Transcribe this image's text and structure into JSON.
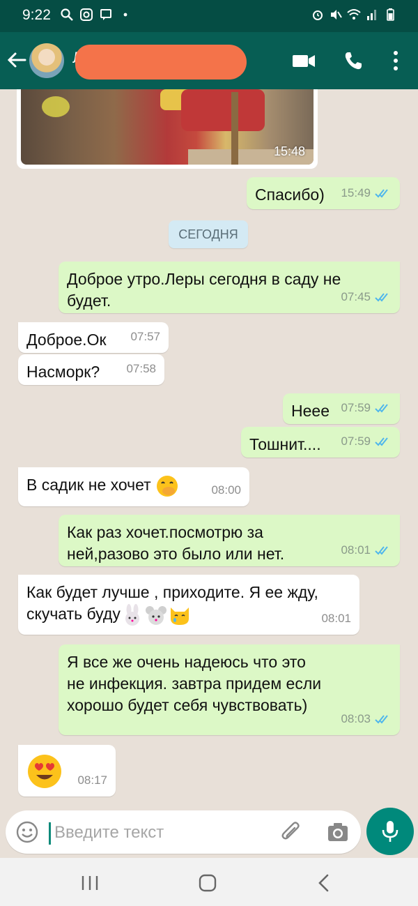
{
  "status_bar": {
    "time": "9:22"
  },
  "header": {
    "contact_name": "Л"
  },
  "media_message": {
    "time": "15:48"
  },
  "messages": [
    {
      "dir": "out",
      "text": "Спасибо)",
      "time": "15:49"
    },
    {
      "dir": "out",
      "text": "Доброе утро.Леры сегодня в саду не будет.",
      "time": "07:45"
    },
    {
      "dir": "in",
      "text": "Доброе.Ок",
      "time": "07:57"
    },
    {
      "dir": "in",
      "text": "Насморк?",
      "time": "07:58"
    },
    {
      "dir": "out",
      "text": "Нееe",
      "time": "07:59"
    },
    {
      "dir": "out",
      "text": "Тошнит....",
      "time": "07:59"
    },
    {
      "dir": "in",
      "text": "В садик не хочет",
      "time": "08:00"
    },
    {
      "dir": "out",
      "text": "Как раз хочет.посмотрю за ней,разово это было или нет.",
      "time": "08:01"
    },
    {
      "dir": "in",
      "text": "Как будет лучше , приходите. Я ее жду, скучать буду",
      "time": "08:01"
    },
    {
      "dir": "out",
      "text": "Я все же очень надеюсь что это не инфекция. завтра придем если хорошо будет себя чувствовать)",
      "time": "08:03"
    },
    {
      "dir": "in",
      "text": "",
      "time": "08:17"
    }
  ],
  "day_separator": "СЕГОДНЯ",
  "input": {
    "placeholder": "Введите текст"
  },
  "colors": {
    "header": "#075e54",
    "status_bar": "#054d44",
    "outgoing_bubble": "#dcf8c6",
    "incoming_bubble": "#ffffff",
    "read_ticks": "#4fb6ec",
    "mic_button": "#00897b"
  },
  "icons": [
    "back-arrow-icon",
    "video-call-icon",
    "phone-icon",
    "more-vert-icon",
    "double-check-icon",
    "smiley-icon",
    "attach-icon",
    "camera-icon",
    "mic-icon"
  ]
}
